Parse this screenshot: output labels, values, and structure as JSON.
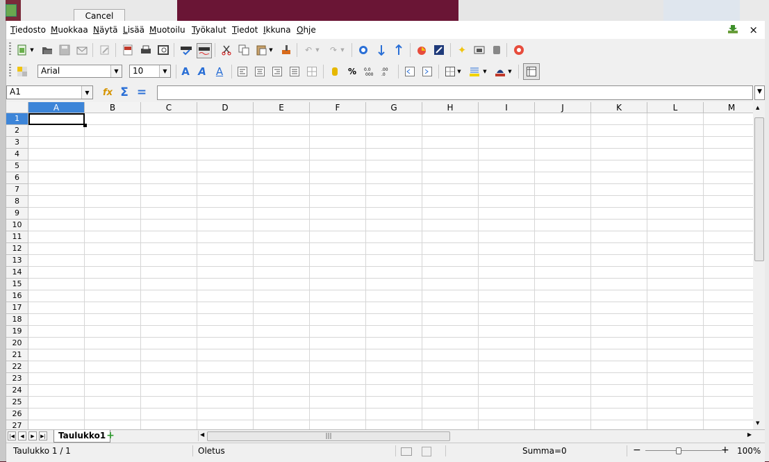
{
  "background": {
    "dialog_cancel_label": "Cancel"
  },
  "menubar": {
    "items": [
      "Tiedosto",
      "Muokkaa",
      "Näytä",
      "Lisää",
      "Muotoilu",
      "Työkalut",
      "Tiedot",
      "Ikkuna",
      "Ohje"
    ],
    "close_glyph": "×"
  },
  "standard_toolbar": {
    "icons": [
      "new-document-icon",
      "open-icon",
      "save-icon",
      "email-icon",
      "edit-file-icon",
      "export-pdf-icon",
      "print-icon",
      "print-preview-icon",
      "spellcheck-icon",
      "autospell-icon",
      "cut-icon",
      "copy-icon",
      "paste-icon",
      "clone-formatting-icon",
      "undo-icon",
      "redo-icon",
      "navigator-icon",
      "sort-ascending-icon",
      "sort-descending-icon",
      "insert-chart-icon",
      "draw-functions-icon",
      "gallery-icon",
      "datasources-icon",
      "help-icon"
    ]
  },
  "format_toolbar": {
    "font_name": "Arial",
    "font_size": "10",
    "percent_glyph": "%"
  },
  "formula_bar": {
    "name_box": "A1",
    "formula_value": "",
    "sum_glyph": "Σ",
    "equals_glyph": "="
  },
  "grid": {
    "columns": [
      "A",
      "B",
      "C",
      "D",
      "E",
      "F",
      "G",
      "H",
      "I",
      "J",
      "K",
      "L",
      "M"
    ],
    "rows": [
      "1",
      "2",
      "3",
      "4",
      "5",
      "6",
      "7",
      "8",
      "9",
      "10",
      "11",
      "12",
      "13",
      "14",
      "15",
      "16",
      "17",
      "18",
      "19",
      "20",
      "21",
      "22",
      "23",
      "24",
      "25",
      "26",
      "27"
    ],
    "selected_cell": "A1"
  },
  "sheet_tabs": {
    "tabs": [
      "Taulukko1"
    ],
    "add_glyph": "+"
  },
  "statusbar": {
    "sheet_info": "Taulukko 1 / 1",
    "page_style": "Oletus",
    "sum_text": "Summa=0",
    "zoom_minus": "−",
    "zoom_plus": "+",
    "zoom": "100%"
  }
}
